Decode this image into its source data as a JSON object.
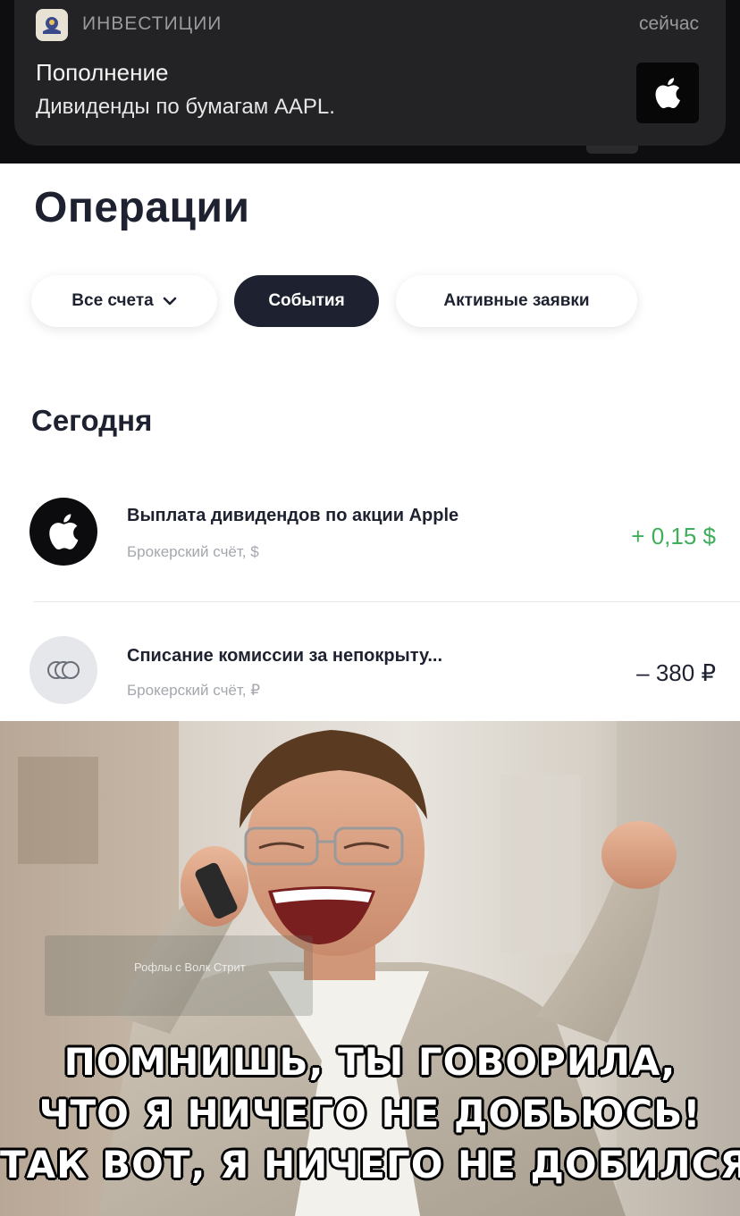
{
  "notification": {
    "app_name": "ИНВЕСТИЦИИ",
    "time": "сейчас",
    "title": "Пополнение",
    "body": "Дивиденды по бумагам AAPL."
  },
  "page": {
    "title": "Операции"
  },
  "filters": {
    "all_accounts": "Все счета",
    "events": "События",
    "active_orders": "Активные заявки",
    "selected": "События"
  },
  "section": {
    "title": "Сегодня"
  },
  "operations": [
    {
      "title": "Выплата дивидендов по акции Apple",
      "subtitle": "Брокерский счёт, $",
      "amount": "+ 0,15 $",
      "amount_color": "#3fae5a",
      "icon": "apple-logo-icon"
    },
    {
      "title": "Списание комиссии за непокрыту...",
      "subtitle": "Брокерский счёт, ₽",
      "amount": "– 380 ₽",
      "amount_color": "#1e2230",
      "icon": "coins-icon"
    }
  ],
  "meme": {
    "watermark": "Рофлы с Волк Стрит",
    "caption_lines": [
      "ПОМНИШЬ, ТЫ ГОВОРИЛА,",
      "ЧТО Я НИЧЕГО НЕ ДОБЬЮСЬ!",
      "ТАК ВОТ, Я НИЧЕГО НЕ ДОБИЛСЯ!"
    ]
  },
  "colors": {
    "primary_dark": "#1e2230",
    "positive": "#3fae5a",
    "muted": "#a4a7ae"
  }
}
